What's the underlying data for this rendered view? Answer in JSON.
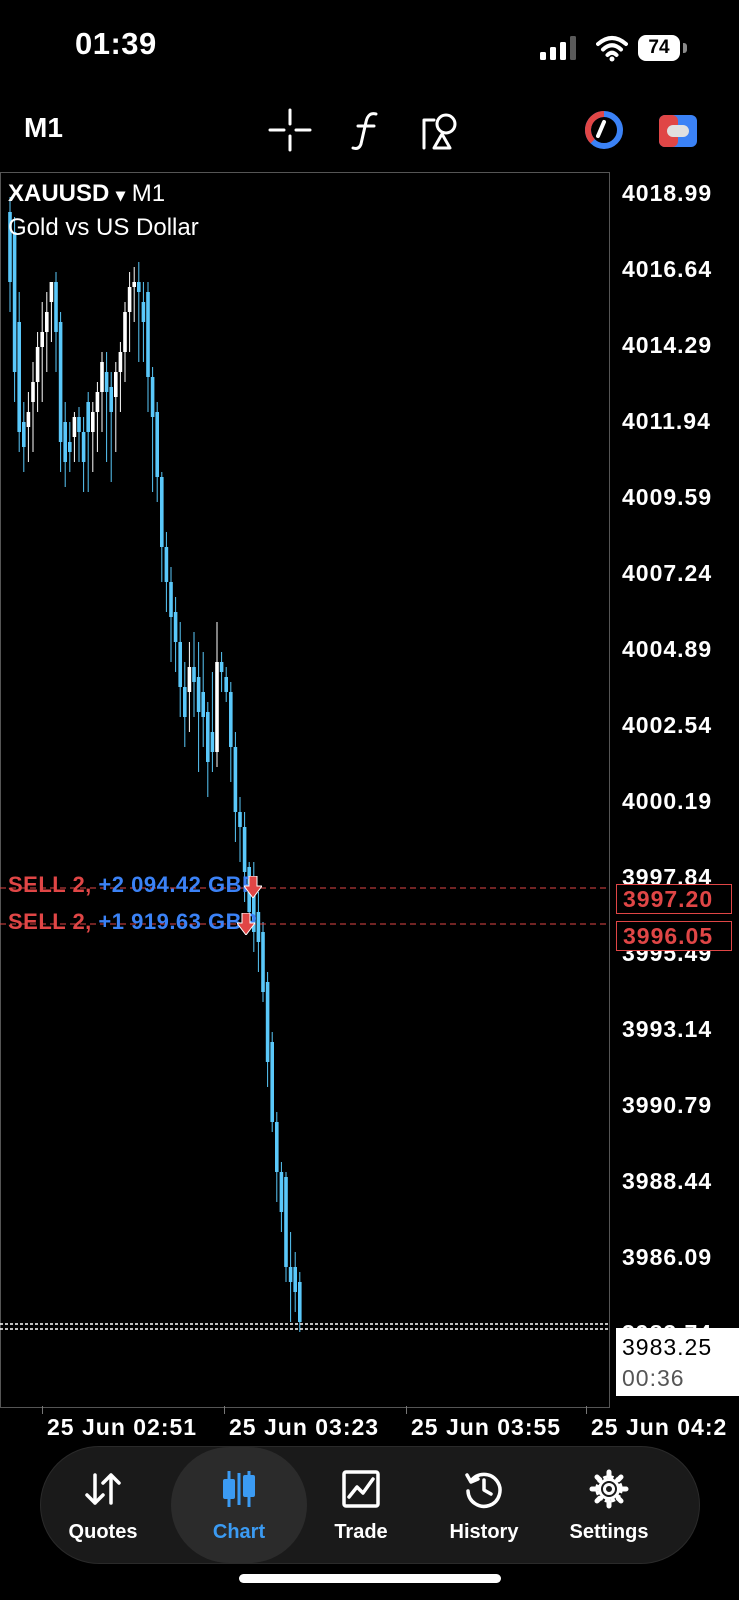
{
  "status_bar": {
    "time": "01:39",
    "battery": "74"
  },
  "toolbar": {
    "timeframe": "M1",
    "icons": [
      "crosshair-icon",
      "indicators-icon",
      "objects-icon",
      "chart-color-icon",
      "toggle-icon"
    ]
  },
  "chart": {
    "symbol": "XAUUSD",
    "dropdown_glyph": "▾",
    "timeframe": "M1",
    "description": "Gold vs US Dollar",
    "price_labels": [
      "4018.99",
      "4016.64",
      "4014.29",
      "4011.94",
      "4009.59",
      "4007.24",
      "4004.89",
      "4002.54",
      "4000.19",
      "3997.84",
      "3995.49",
      "3993.14",
      "3990.79",
      "3988.44",
      "3986.09",
      "3983.74"
    ],
    "time_labels": [
      "25 Jun 02:51",
      "25 Jun 03:23",
      "25 Jun 03:55",
      "25 Jun 04:2"
    ],
    "orders": [
      {
        "side": "SELL 2,",
        "profit": "+2 094.42 GBP",
        "price": "3997.20"
      },
      {
        "side": "SELL 2,",
        "profit": "+1 919.63 GBP",
        "price": "3996.05"
      }
    ],
    "bid": {
      "price": "3983.25",
      "countdown": "00:36"
    },
    "colors": {
      "bull": "#ffffff",
      "bear": "#5ac8fa",
      "sell": "#e04646",
      "profit": "#3b82f6",
      "grid": "#555555"
    }
  },
  "nav": {
    "items": [
      {
        "label": "Quotes",
        "icon": "quotes-icon"
      },
      {
        "label": "Chart",
        "icon": "chart-icon",
        "active": true
      },
      {
        "label": "Trade",
        "icon": "trade-icon"
      },
      {
        "label": "History",
        "icon": "history-icon"
      },
      {
        "label": "Settings",
        "icon": "settings-icon"
      }
    ]
  }
}
